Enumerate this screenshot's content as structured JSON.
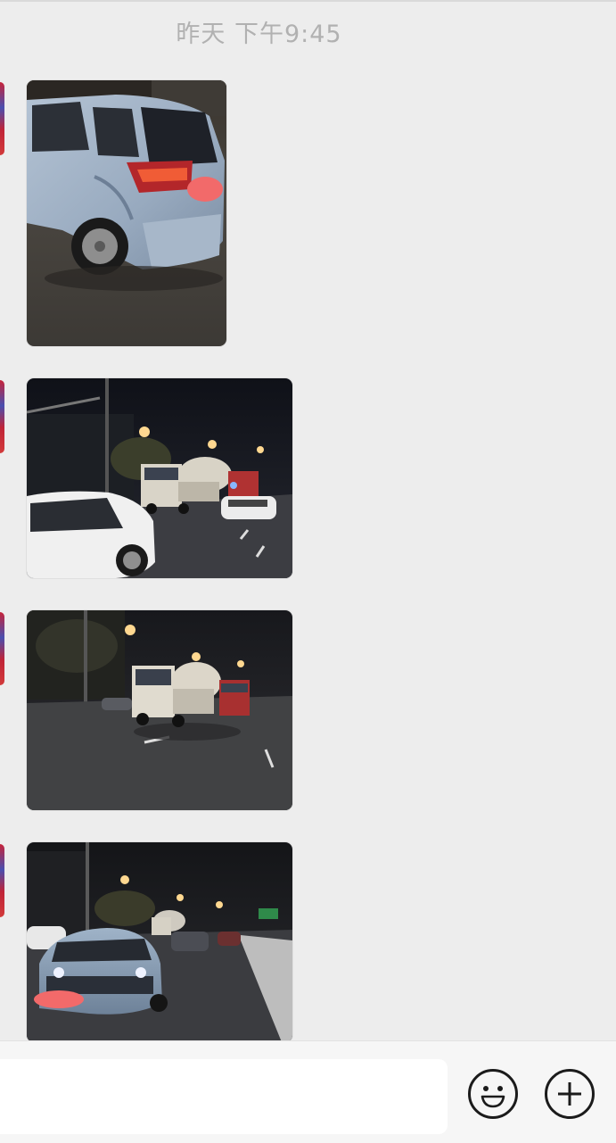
{
  "chat": {
    "timestamp": "昨天 下午9:45",
    "messages": [
      {
        "type": "image",
        "icon": "photo-damaged-car-rear"
      },
      {
        "type": "image",
        "icon": "photo-night-road-mixer-truck"
      },
      {
        "type": "image",
        "icon": "photo-night-road-mixer-truck-front"
      },
      {
        "type": "image",
        "icon": "photo-night-road-blue-car"
      }
    ]
  },
  "input_bar": {
    "text_value": "",
    "emoji_icon": "emoji-smile-icon",
    "plus_icon": "plus-circle-icon"
  },
  "colors": {
    "background": "#ededed",
    "timestamp": "#b1b1b1",
    "input_bar": "#f6f6f6"
  }
}
